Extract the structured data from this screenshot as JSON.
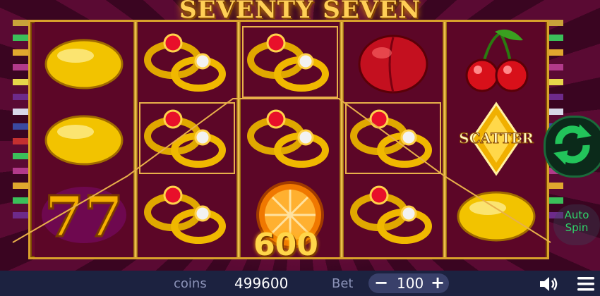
{
  "game": {
    "title": "SEVENTY SEVEN",
    "win_amount": "600",
    "scatter_label": "SCATTER"
  },
  "reels": [
    [
      "lemon",
      "lemon",
      "seven-seven"
    ],
    [
      "ring",
      "ring",
      "ring"
    ],
    [
      "ring",
      "ring",
      "orange"
    ],
    [
      "plum",
      "ring",
      "ring"
    ],
    [
      "cherries",
      "scatter-star",
      "lemon"
    ]
  ],
  "footer": {
    "coins_label": "coins",
    "coins_value": "499600",
    "bet_label": "Bet",
    "bet_value": "100",
    "minus": "−",
    "plus": "+"
  },
  "controls": {
    "auto_spin_label_1": "Auto",
    "auto_spin_label_2": "Spin"
  },
  "colors": {
    "accent_gold": "#ffcf56",
    "spin_green": "#2fd36a",
    "footer_bg": "#1c2240"
  }
}
